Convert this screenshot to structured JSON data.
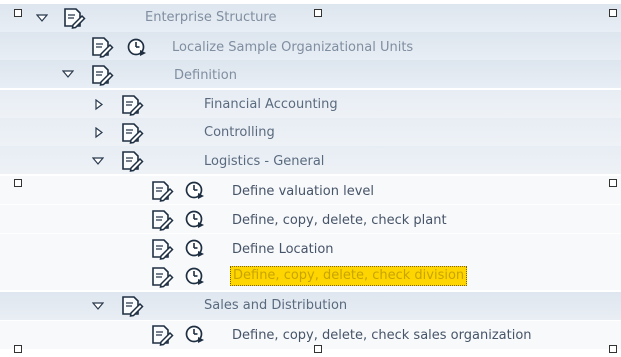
{
  "tree": {
    "enterprise_structure": "Enterprise Structure",
    "localize_sample": "Localize Sample Organizational Units",
    "definition": "Definition",
    "financial_accounting": "Financial Accounting",
    "controlling": "Controlling",
    "logistics_general": "Logistics - General",
    "define_valuation_level": "Define valuation level",
    "define_plant": "Define, copy, delete, check plant",
    "define_location": "Define Location",
    "define_division": "Define, copy, delete, check division",
    "sales_distribution": "Sales and Distribution",
    "define_sales_org": "Define, copy, delete, check sales organization"
  },
  "icons": {
    "document": "document-pencil-icon",
    "execute": "clock-execute-icon",
    "expand": "triangle-right-icon",
    "collapse": "triangle-down-icon"
  },
  "colors": {
    "selection": "#ffd500",
    "band": "#dde5ee"
  }
}
